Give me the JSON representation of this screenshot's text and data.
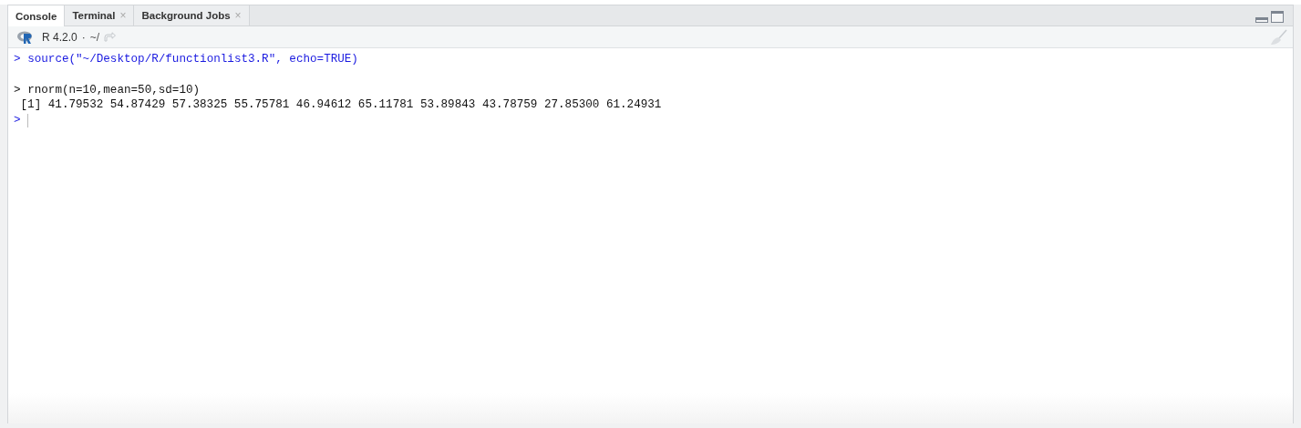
{
  "tabs": [
    {
      "label": "Console",
      "selected": true
    },
    {
      "label": "Terminal",
      "selected": false,
      "close": "×"
    },
    {
      "label": "Background Jobs",
      "selected": false,
      "close": "×"
    }
  ],
  "toolbar": {
    "version": "R 4.2.0",
    "separator": "·",
    "path": "~/"
  },
  "console": [
    {
      "kind": "command",
      "prompt": ">",
      "text": "source(\"~/Desktop/R/functionlist3.R\", echo=TRUE)"
    },
    {
      "kind": "blank"
    },
    {
      "kind": "echo",
      "prompt": ">",
      "text": "rnorm(n=10,mean=50,sd=10)"
    },
    {
      "kind": "output",
      "text": " [1] 41.79532 54.87429 57.38325 55.75781 46.94612 65.11781 53.89843 43.78759 27.85300 61.24931"
    },
    {
      "kind": "prompt",
      "prompt": ">"
    }
  ]
}
